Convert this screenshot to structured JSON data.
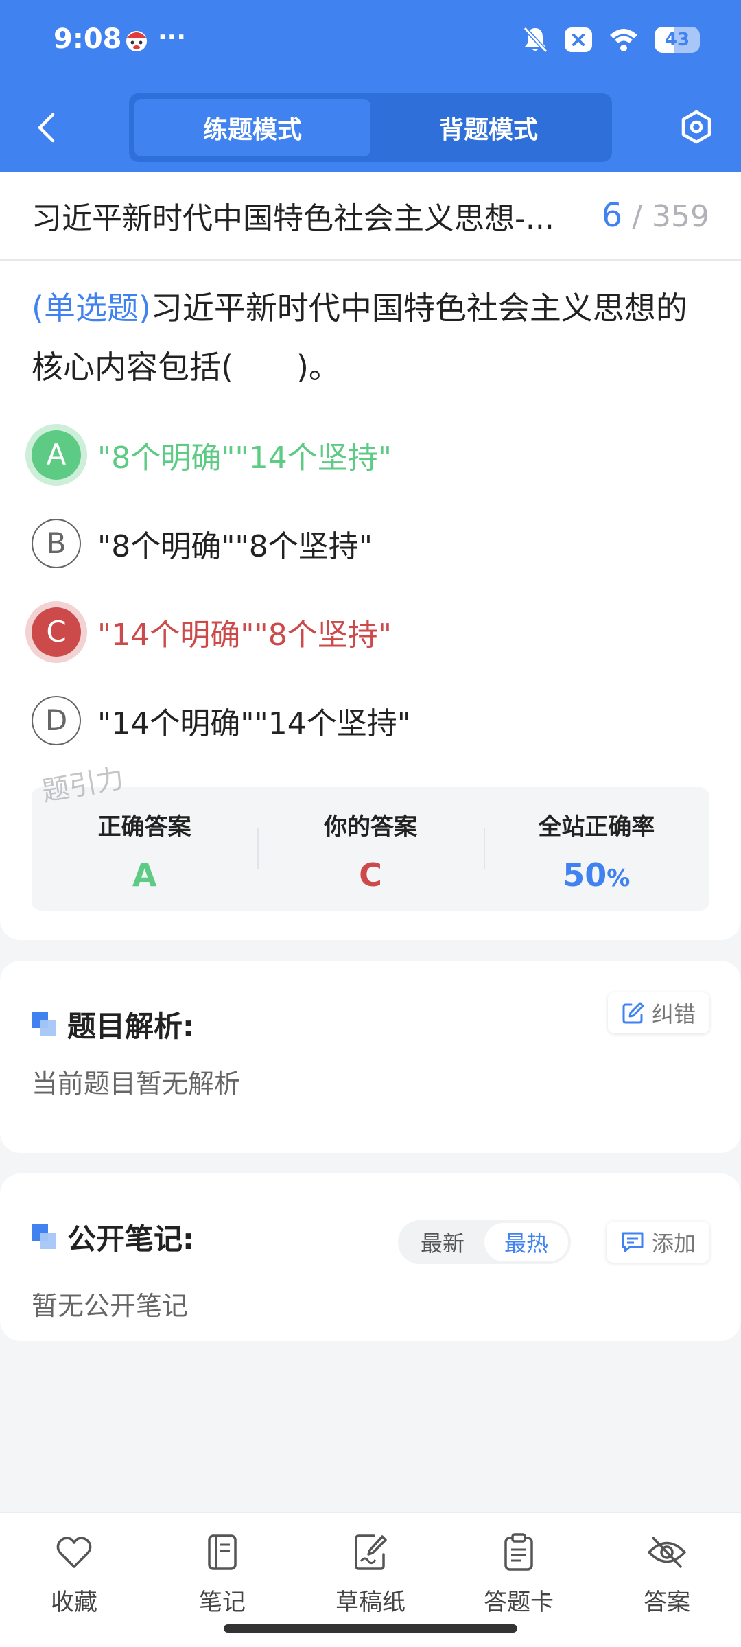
{
  "status": {
    "time": "9:08",
    "dots": "···",
    "battery": "43",
    "icons": [
      "bell-off-icon",
      "close-box-icon",
      "wifi-icon",
      "battery-icon"
    ]
  },
  "nav": {
    "tabs": [
      {
        "label": "练题模式",
        "active": true
      },
      {
        "label": "背题模式",
        "active": false
      }
    ],
    "icons": [
      "back-chevron-icon",
      "settings-hex-icon"
    ]
  },
  "paper": {
    "title": "习近平新时代中国特色社会主义思想-...",
    "current": "6",
    "separator": "/",
    "total": "359"
  },
  "question": {
    "type": "(单选题)",
    "text": "习近平新时代中国特色社会主义思想的核心内容包括(　　)。",
    "options": [
      {
        "letter": "A",
        "text": "\"8个明确\"\"14个坚持\"",
        "state": "correct"
      },
      {
        "letter": "B",
        "text": "\"8个明确\"\"8个坚持\"",
        "state": "normal"
      },
      {
        "letter": "C",
        "text": "\"14个明确\"\"8个坚持\"",
        "state": "wrong"
      },
      {
        "letter": "D",
        "text": "\"14个明确\"\"14个坚持\"",
        "state": "normal"
      }
    ]
  },
  "result": {
    "correct_label": "正确答案",
    "correct_value": "A",
    "yours_label": "你的答案",
    "yours_value": "C",
    "rate_label": "全站正确率",
    "rate_value": "50",
    "rate_unit": "%",
    "watermark": "题引力"
  },
  "analysis": {
    "title": "题目解析:",
    "report_label": "纠错",
    "empty_text": "当前题目暂无解析"
  },
  "notes": {
    "title": "公开笔记:",
    "sort_latest": "最新",
    "sort_hot": "最热",
    "add_label": "添加",
    "empty_text": "暂无公开笔记"
  },
  "bottom_bar": [
    {
      "label": "收藏",
      "icon": "heart-icon"
    },
    {
      "label": "笔记",
      "icon": "notebook-icon"
    },
    {
      "label": "草稿纸",
      "icon": "draft-paper-icon"
    },
    {
      "label": "答题卡",
      "icon": "answer-card-icon"
    },
    {
      "label": "答案",
      "icon": "eye-off-icon"
    }
  ],
  "colors": {
    "primary": "#3f82f0",
    "correct": "#5dcb84",
    "wrong": "#cc4a4a"
  }
}
